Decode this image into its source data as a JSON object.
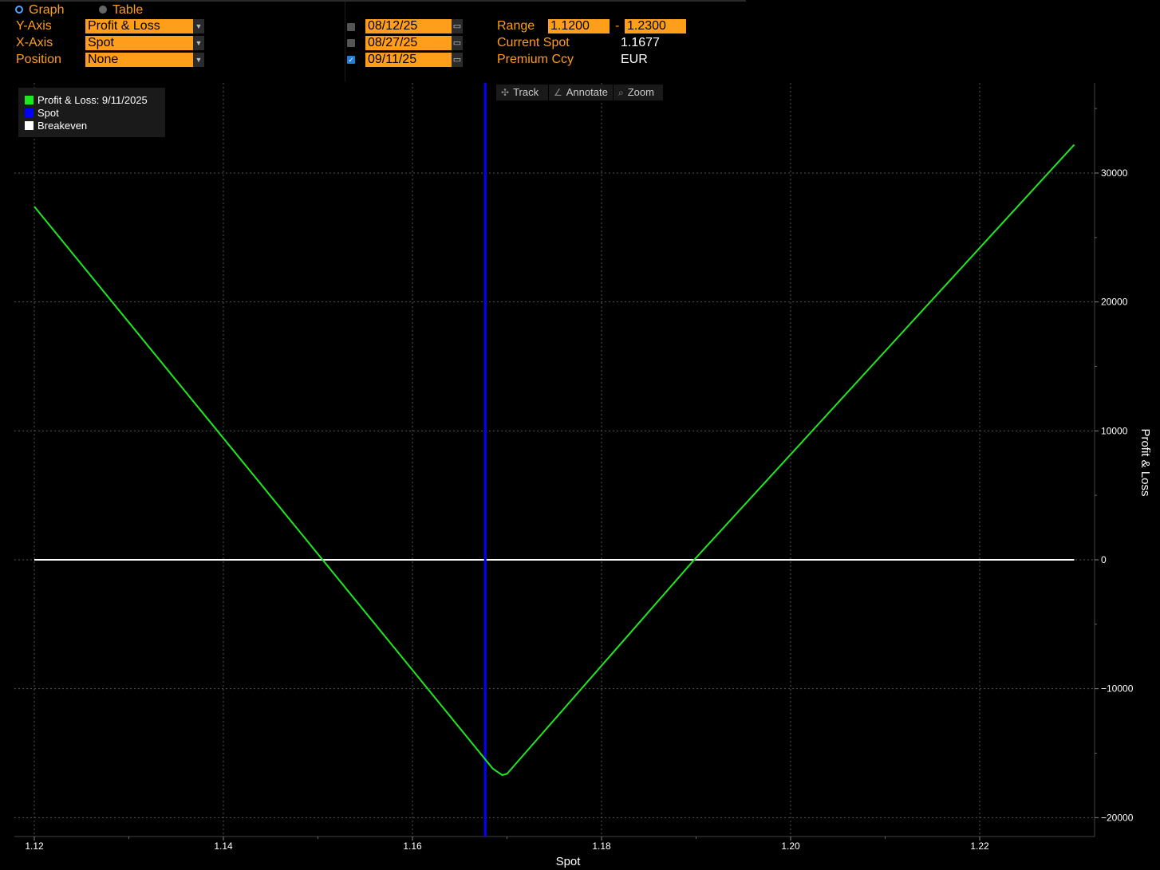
{
  "view_toggle": {
    "graph_label": "Graph",
    "table_label": "Table",
    "selected": "Graph"
  },
  "controls": {
    "y_axis": {
      "label": "Y-Axis",
      "value": "Profit & Loss"
    },
    "x_axis": {
      "label": "X-Axis",
      "value": "Spot"
    },
    "position": {
      "label": "Position",
      "value": "None"
    }
  },
  "dates": [
    {
      "value": "08/12/25",
      "checked": false
    },
    {
      "value": "08/27/25",
      "checked": false
    },
    {
      "value": "09/11/25",
      "checked": true
    }
  ],
  "info": {
    "range_label": "Range",
    "range_from": "1.1200",
    "range_sep": "-",
    "range_to": "1.2300",
    "current_spot_label": "Current Spot",
    "current_spot_value": "1.1677",
    "premium_ccy_label": "Premium Ccy",
    "premium_ccy_value": "EUR"
  },
  "toolbar": {
    "track": "Track",
    "annotate": "Annotate",
    "zoom": "Zoom"
  },
  "legend": [
    {
      "label": "Profit & Loss: 9/11/2025",
      "color": "#1ee81e"
    },
    {
      "label": "Spot",
      "color": "#0000ff"
    },
    {
      "label": "Breakeven",
      "color": "#ffffff"
    }
  ],
  "chart_data": {
    "type": "line",
    "xlabel": "Spot",
    "ylabel": "Profit & Loss",
    "xlim": [
      1.118,
      1.2335
    ],
    "ylim": [
      -20800,
      36000
    ],
    "x_ticks": [
      "1.12",
      "1.14",
      "1.16",
      "1.18",
      "1.20",
      "1.22"
    ],
    "x_tick_values": [
      1.12,
      1.14,
      1.16,
      1.18,
      1.2,
      1.22
    ],
    "y_ticks": [
      "30000",
      "20000",
      "10000",
      "0",
      "-10000",
      "-20000"
    ],
    "y_tick_values": [
      30000,
      20000,
      10000,
      0,
      -10000,
      -20000
    ],
    "grid": true,
    "legend_position": "top-left",
    "series": [
      {
        "name": "Profit & Loss: 9/11/2025",
        "color": "#1ee81e",
        "x": [
          1.12,
          1.1505,
          1.1685,
          1.1695,
          1.17,
          1.1898,
          1.23
        ],
        "y": [
          27400,
          0,
          -16200,
          -16700,
          -16600,
          0,
          32200
        ]
      }
    ],
    "spot_line": {
      "name": "Spot",
      "x": 1.1677,
      "color": "#0000ff"
    },
    "breakeven_line": {
      "name": "Breakeven",
      "y": 0,
      "x_range": [
        1.12,
        1.23
      ],
      "color": "#ffffff"
    }
  },
  "colors": {
    "accent": "#ff9e1b",
    "background": "#000000",
    "pnl": "#1ee81e",
    "spot": "#0000ff"
  }
}
